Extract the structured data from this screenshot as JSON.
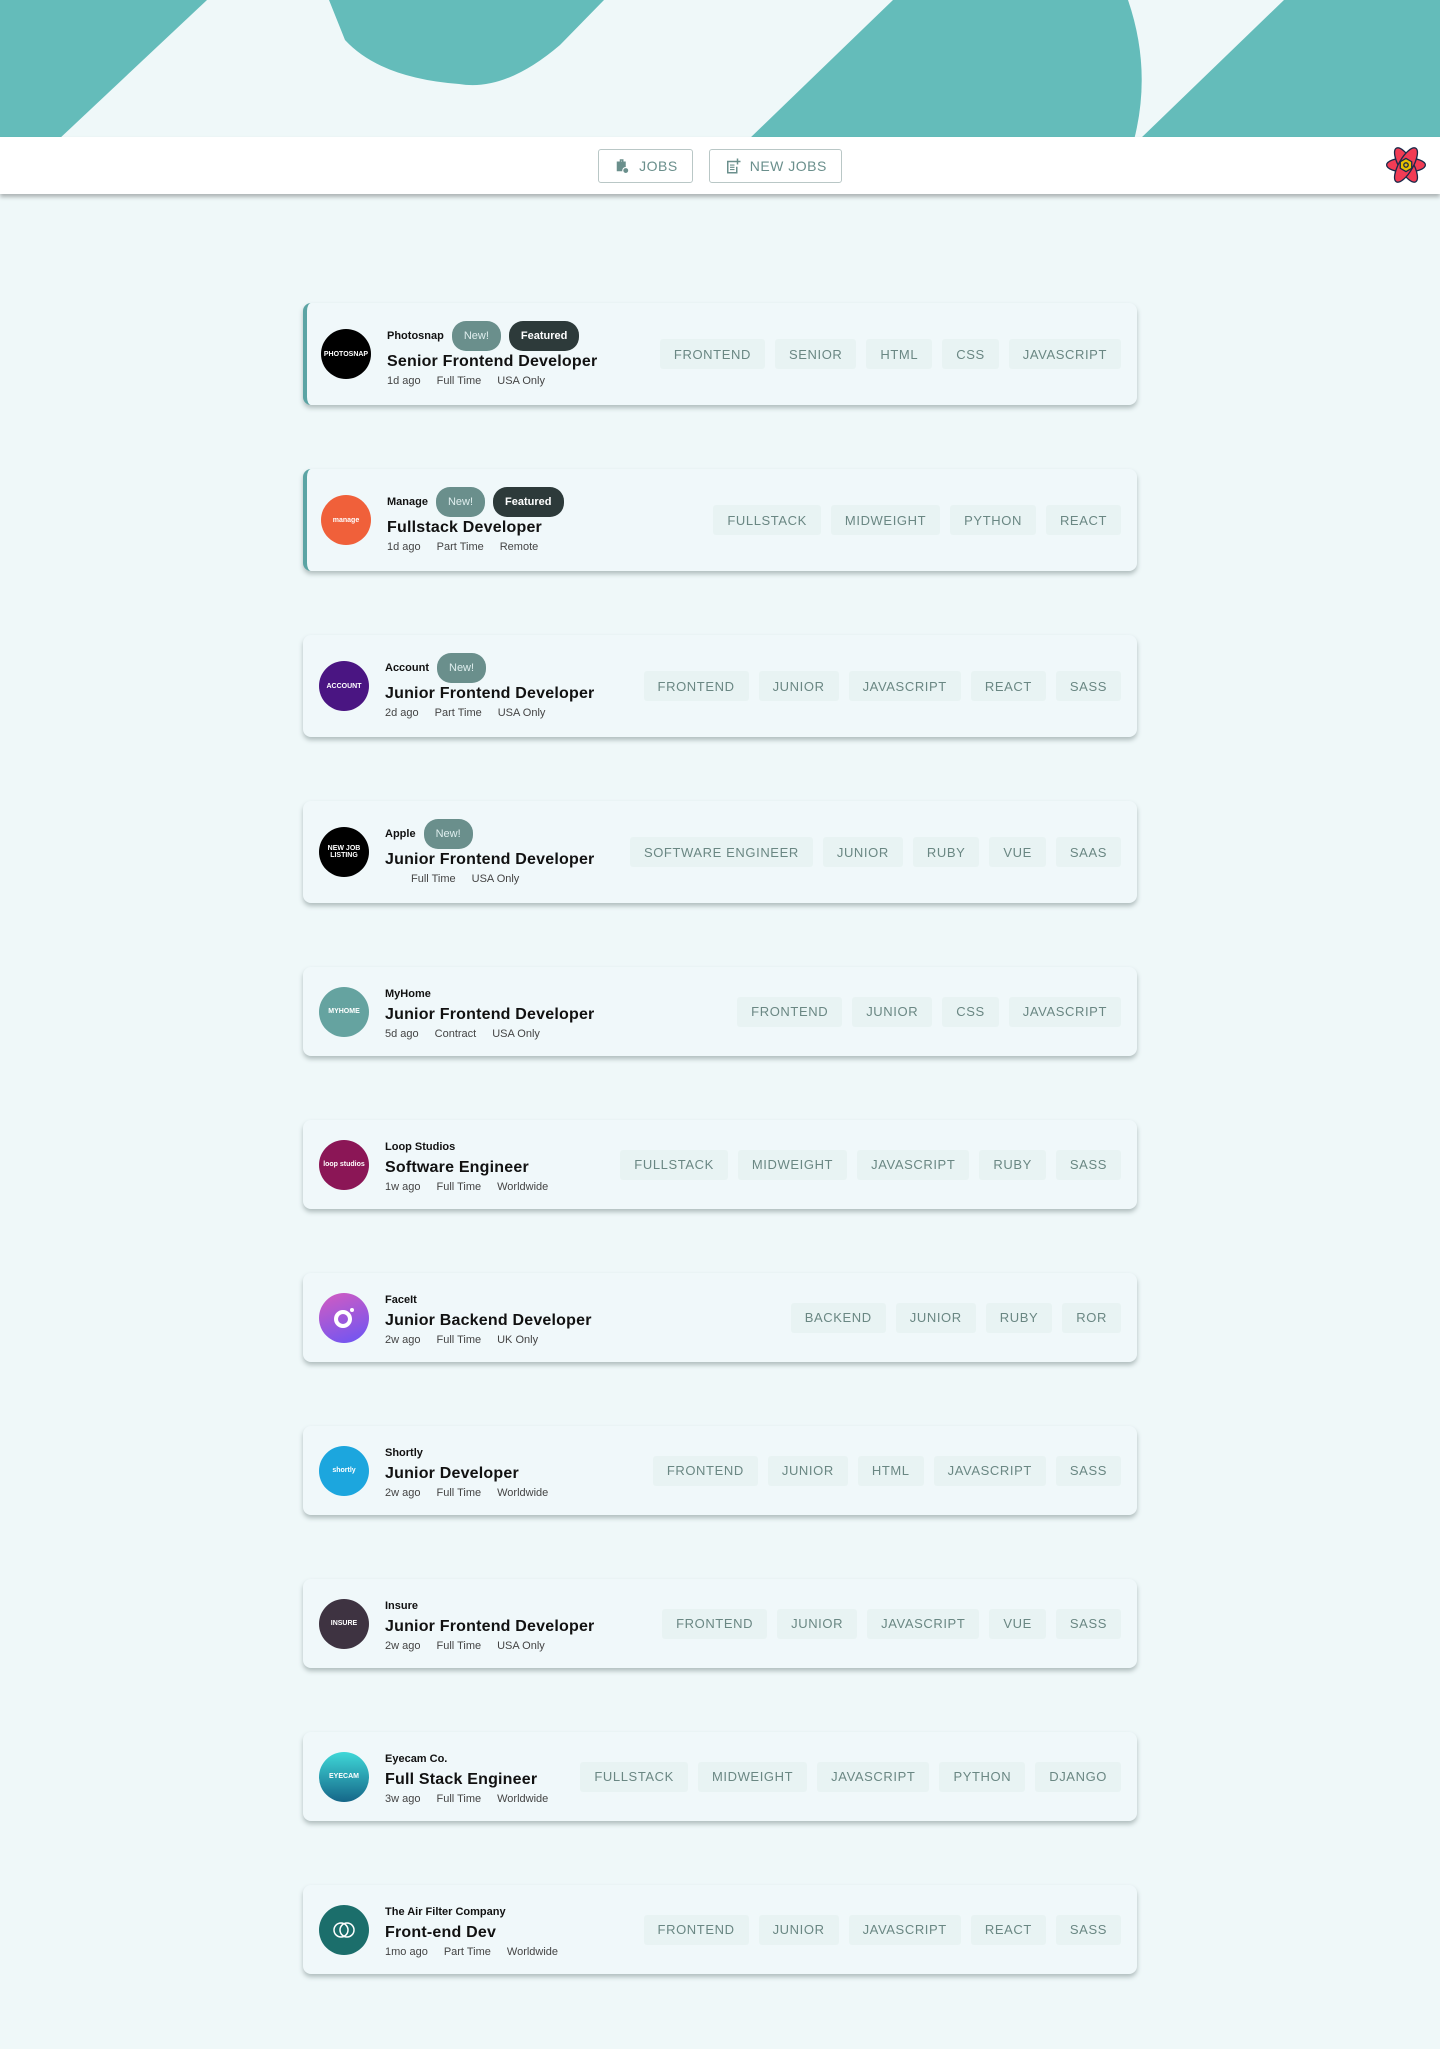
{
  "colors": {
    "accent": "#64bcba",
    "background": "#eff8f9",
    "new_badge": "#6a8f8c",
    "featured_badge": "#2d3a3a"
  },
  "nav": {
    "jobs_label": "JOBS",
    "new_jobs_label": "NEW JOBS",
    "jobs_icon": "briefcase-clock-icon",
    "new_jobs_icon": "post-add-icon",
    "app_logo": "react-atom-icon"
  },
  "jobs": [
    {
      "company": "Photosnap",
      "logo_text": "PHOTOSNAP",
      "logo_color": "#000000",
      "new": "New!",
      "featured": "Featured",
      "title": "Senior Frontend Developer",
      "posted": "1d ago",
      "contract": "Full Time",
      "location": "USA Only",
      "tags": [
        "FRONTEND",
        "SENIOR",
        "HTML",
        "CSS",
        "JAVASCRIPT"
      ]
    },
    {
      "company": "Manage",
      "logo_text": "manage",
      "logo_color": "#f0603a",
      "new": "New!",
      "featured": "Featured",
      "title": "Fullstack Developer",
      "posted": "1d ago",
      "contract": "Part Time",
      "location": "Remote",
      "tags": [
        "FULLSTACK",
        "MIDWEIGHT",
        "PYTHON",
        "REACT"
      ]
    },
    {
      "company": "Account",
      "logo_text": "ACCOUNT",
      "logo_color": "#4a1582",
      "new": "New!",
      "title": "Junior Frontend Developer",
      "posted": "2d ago",
      "contract": "Part Time",
      "location": "USA Only",
      "tags": [
        "FRONTEND",
        "JUNIOR",
        "JAVASCRIPT",
        "REACT",
        "SASS"
      ]
    },
    {
      "company": "Apple",
      "logo_text": "NEW JOB LISTING",
      "logo_color": "#000000",
      "new": "New!",
      "title": "Junior Frontend Developer",
      "posted": "",
      "contract": "Full Time",
      "location": "USA Only",
      "tags": [
        "SOFTWARE ENGINEER",
        "JUNIOR",
        "RUBY",
        "VUE",
        "SAAS"
      ]
    },
    {
      "company": "MyHome",
      "logo_text": "MYHOME",
      "logo_color": "#65a3a0",
      "title": "Junior Frontend Developer",
      "posted": "5d ago",
      "contract": "Contract",
      "location": "USA Only",
      "tags": [
        "FRONTEND",
        "JUNIOR",
        "CSS",
        "JAVASCRIPT"
      ]
    },
    {
      "company": "Loop Studios",
      "logo_text": "loop studios",
      "logo_color": "#8b1656",
      "title": "Software Engineer",
      "posted": "1w ago",
      "contract": "Full Time",
      "location": "Worldwide",
      "tags": [
        "FULLSTACK",
        "MIDWEIGHT",
        "JAVASCRIPT",
        "RUBY",
        "SASS"
      ]
    },
    {
      "company": "FaceIt",
      "logo_text": "",
      "logo_color": "linear-gradient(160deg,#d45cc0,#6a55f5)",
      "title": "Junior Backend Developer",
      "posted": "2w ago",
      "contract": "Full Time",
      "location": "UK Only",
      "tags": [
        "BACKEND",
        "JUNIOR",
        "RUBY",
        "ROR"
      ]
    },
    {
      "company": "Shortly",
      "logo_text": "shortly",
      "logo_color": "#1ca6de",
      "title": "Junior Developer",
      "posted": "2w ago",
      "contract": "Full Time",
      "location": "Worldwide",
      "tags": [
        "FRONTEND",
        "JUNIOR",
        "HTML",
        "JAVASCRIPT",
        "SASS"
      ]
    },
    {
      "company": "Insure",
      "logo_text": "INSURE",
      "logo_color": "#3e3341",
      "title": "Junior Frontend Developer",
      "posted": "2w ago",
      "contract": "Full Time",
      "location": "USA Only",
      "tags": [
        "FRONTEND",
        "JUNIOR",
        "JAVASCRIPT",
        "VUE",
        "SASS"
      ]
    },
    {
      "company": "Eyecam Co.",
      "logo_text": "EYECAM",
      "logo_color": "linear-gradient(180deg,#3fd8d8,#156688)",
      "title": "Full Stack Engineer",
      "posted": "3w ago",
      "contract": "Full Time",
      "location": "Worldwide",
      "tags": [
        "FULLSTACK",
        "MIDWEIGHT",
        "JAVASCRIPT",
        "PYTHON",
        "DJANGO"
      ]
    },
    {
      "company": "The Air Filter Company",
      "logo_text": "",
      "logo_color": "#1b6e6b",
      "title": "Front-end Dev",
      "posted": "1mo ago",
      "contract": "Part Time",
      "location": "Worldwide",
      "tags": [
        "FRONTEND",
        "JUNIOR",
        "JAVASCRIPT",
        "REACT",
        "SASS"
      ]
    }
  ]
}
